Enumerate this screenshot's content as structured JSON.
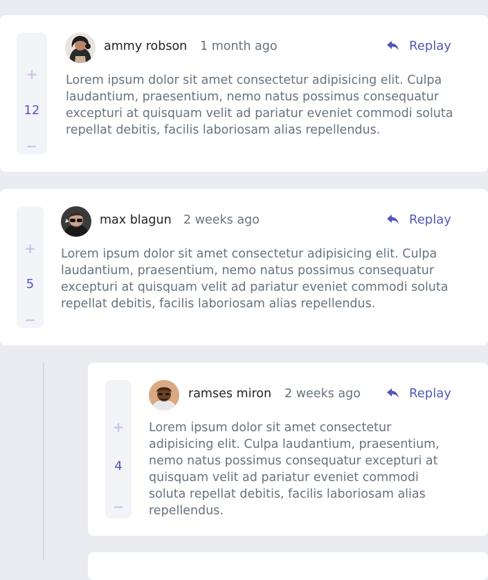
{
  "comments": [
    {
      "username": "ammy robson",
      "time": "1 month ago",
      "score": "12",
      "reply_label": "Replay",
      "content": "Lorem ipsum dolor sit amet consectetur adipisicing elit. Culpa laudantium, praesentium, nemo natus possimus consequatur excepturi at quisquam velit ad pariatur eveniet commodi soluta repellat debitis, facilis laboriosam alias repellendus."
    },
    {
      "username": "max blagun",
      "time": "2 weeks ago",
      "score": "5",
      "reply_label": "Replay",
      "content": "Lorem ipsum dolor sit amet consectetur adipisicing elit. Culpa laudantium, praesentium, nemo natus possimus consequatur excepturi at quisquam velit ad pariatur eveniet commodi soluta repellat debitis, facilis laboriosam alias repellendus."
    }
  ],
  "replies": [
    {
      "username": "ramses miron",
      "time": "2 weeks ago",
      "score": "4",
      "reply_label": "Replay",
      "content": "Lorem ipsum dolor sit amet consectetur adipisicing elit. Culpa laudantium, praesentium, nemo natus possimus consequatur excepturi at quisquam velit ad pariatur eveniet commodi soluta repellat debitis, facilis laboriosam alias repellendus."
    }
  ],
  "vote": {
    "plus": "+",
    "minus": "−"
  },
  "colors": {
    "accent": "#5357b6",
    "vote_symbol": "#c5c6ef",
    "background": "#eaecf1",
    "card": "#ffffff",
    "text_muted": "#67727e"
  },
  "icons": {
    "reply": "reply-arrow-icon"
  }
}
